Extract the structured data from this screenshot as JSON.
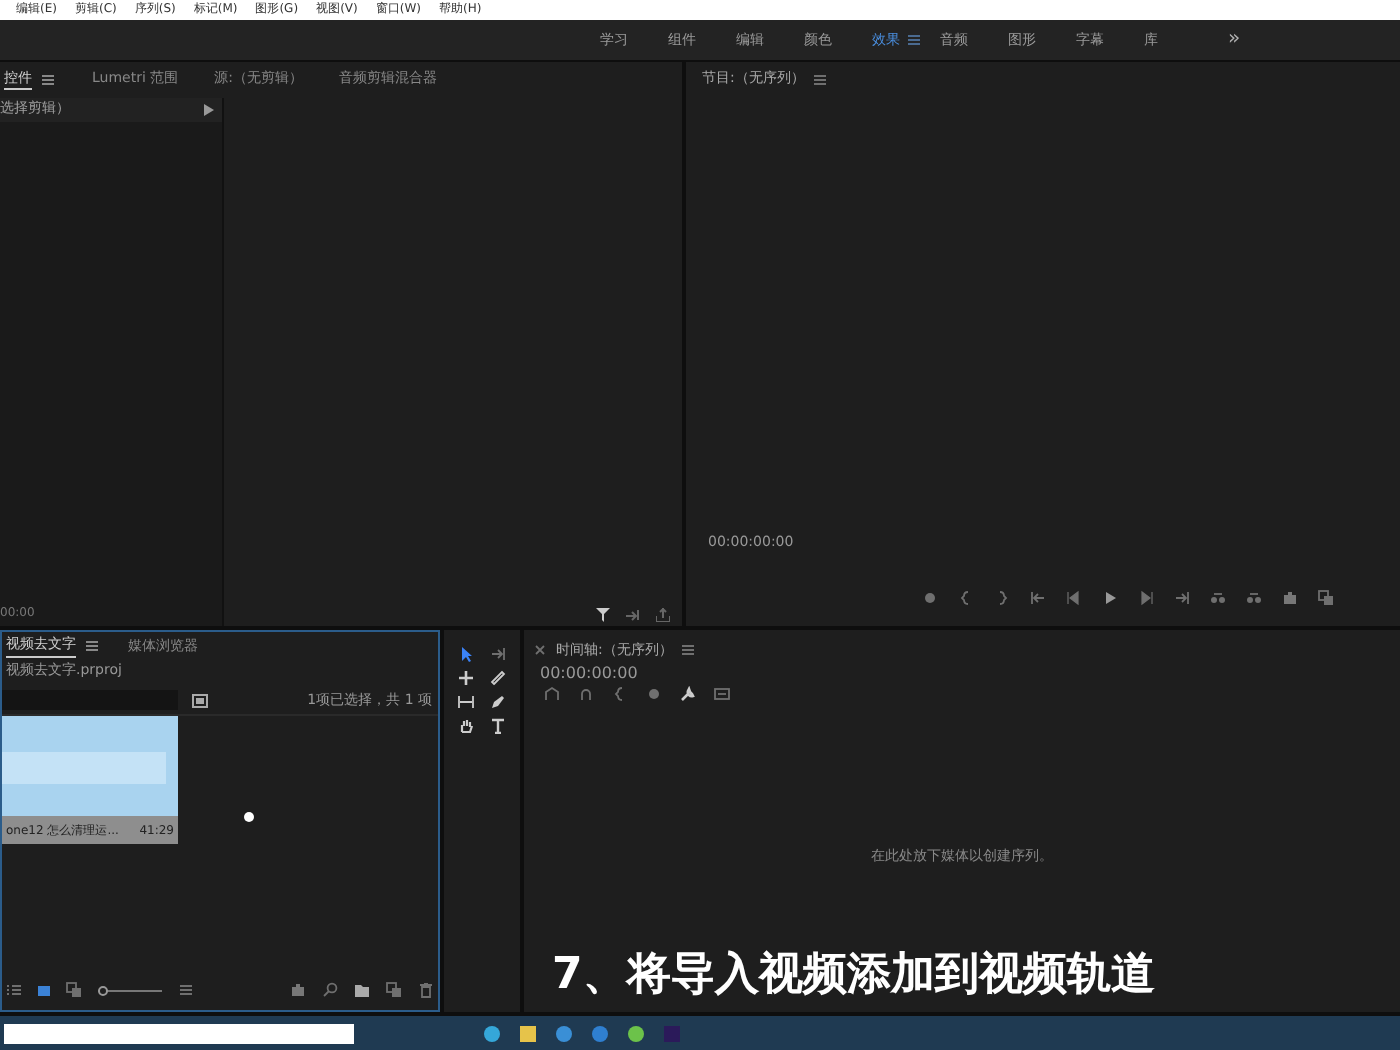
{
  "menu": [
    "编辑(E)",
    "剪辑(C)",
    "序列(S)",
    "标记(M)",
    "图形(G)",
    "视图(V)",
    "窗口(W)",
    "帮助(H)"
  ],
  "workspaces": [
    {
      "label": "学习",
      "selected": false
    },
    {
      "label": "组件",
      "selected": false
    },
    {
      "label": "编辑",
      "selected": false
    },
    {
      "label": "颜色",
      "selected": false
    },
    {
      "label": "效果",
      "selected": true
    },
    {
      "label": "音频",
      "selected": false
    },
    {
      "label": "图形",
      "selected": false
    },
    {
      "label": "字幕",
      "selected": false
    },
    {
      "label": "库",
      "selected": false
    }
  ],
  "more_workspaces": "»",
  "source_panel": {
    "tabs": [
      {
        "label": "控件",
        "selected": true
      },
      {
        "label": "Lumetri 范围",
        "selected": false
      },
      {
        "label": "源:（无剪辑）",
        "selected": false
      },
      {
        "label": "音频剪辑混合器",
        "selected": false
      }
    ],
    "clip_label": "选择剪辑）",
    "timecode": "00:00"
  },
  "program_panel": {
    "title": "节目:（无序列）",
    "timecode": "00:00:00:00"
  },
  "project_panel": {
    "tabs": [
      {
        "label": "视频去文字",
        "selected": true
      },
      {
        "label": "媒体浏览器",
        "selected": false
      }
    ],
    "project_file": "视频去文字.prproj",
    "selection_info": "1项已选择，共 1 项",
    "clip": {
      "name": "one12 怎么清理运...",
      "duration": "41:29"
    },
    "zoom_slider": {
      "level": 0
    }
  },
  "timeline": {
    "title": "时间轴:（无序列）",
    "timecode": "00:00:00:00",
    "drop_hint": "在此处放下媒体以创建序列。"
  },
  "caption": "7、将导入视频添加到视频轨道"
}
